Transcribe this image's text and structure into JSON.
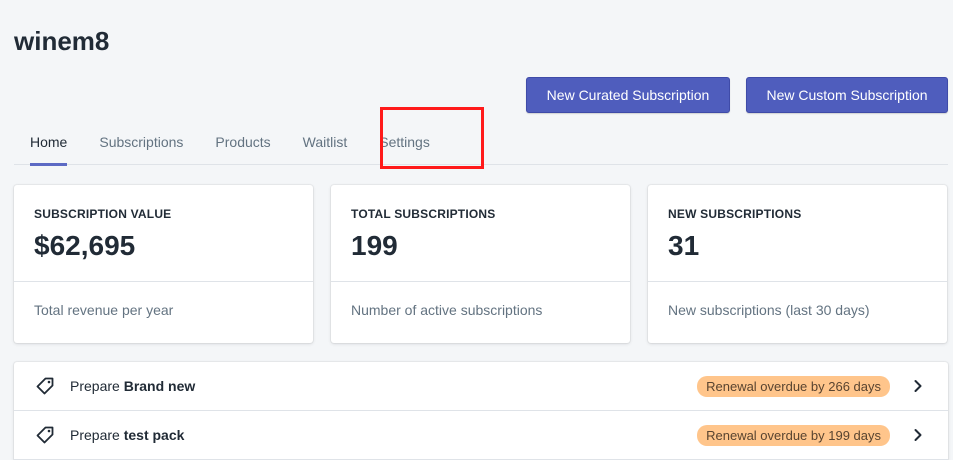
{
  "app": {
    "title": "winem8"
  },
  "actions": {
    "curated_label": "New Curated Subscription",
    "custom_label": "New Custom Subscription"
  },
  "tabs": [
    {
      "label": "Home",
      "active": true
    },
    {
      "label": "Subscriptions",
      "active": false
    },
    {
      "label": "Products",
      "active": false
    },
    {
      "label": "Waitlist",
      "active": false
    },
    {
      "label": "Settings",
      "active": false
    }
  ],
  "cards": [
    {
      "label": "SUBSCRIPTION VALUE",
      "value": "$62,695",
      "caption": "Total revenue per year"
    },
    {
      "label": "TOTAL SUBSCRIPTIONS",
      "value": "199",
      "caption": "Number of active subscriptions"
    },
    {
      "label": "NEW SUBSCRIPTIONS",
      "value": "31",
      "caption": "New subscriptions (last 30 days)"
    }
  ],
  "tasks": [
    {
      "prefix": "Prepare",
      "name": "Brand new",
      "badge": "Renewal overdue by 266 days",
      "icon": "tag-icon"
    },
    {
      "prefix": "Prepare",
      "name": "test pack",
      "badge": "Renewal overdue by 199 days",
      "icon": "tag-icon"
    }
  ],
  "colors": {
    "primary_button": "#4f5dbd",
    "active_tab_underline": "#5c6ac4",
    "highlight_box": "#ff1a1a",
    "badge_bg": "#ffc58b"
  }
}
